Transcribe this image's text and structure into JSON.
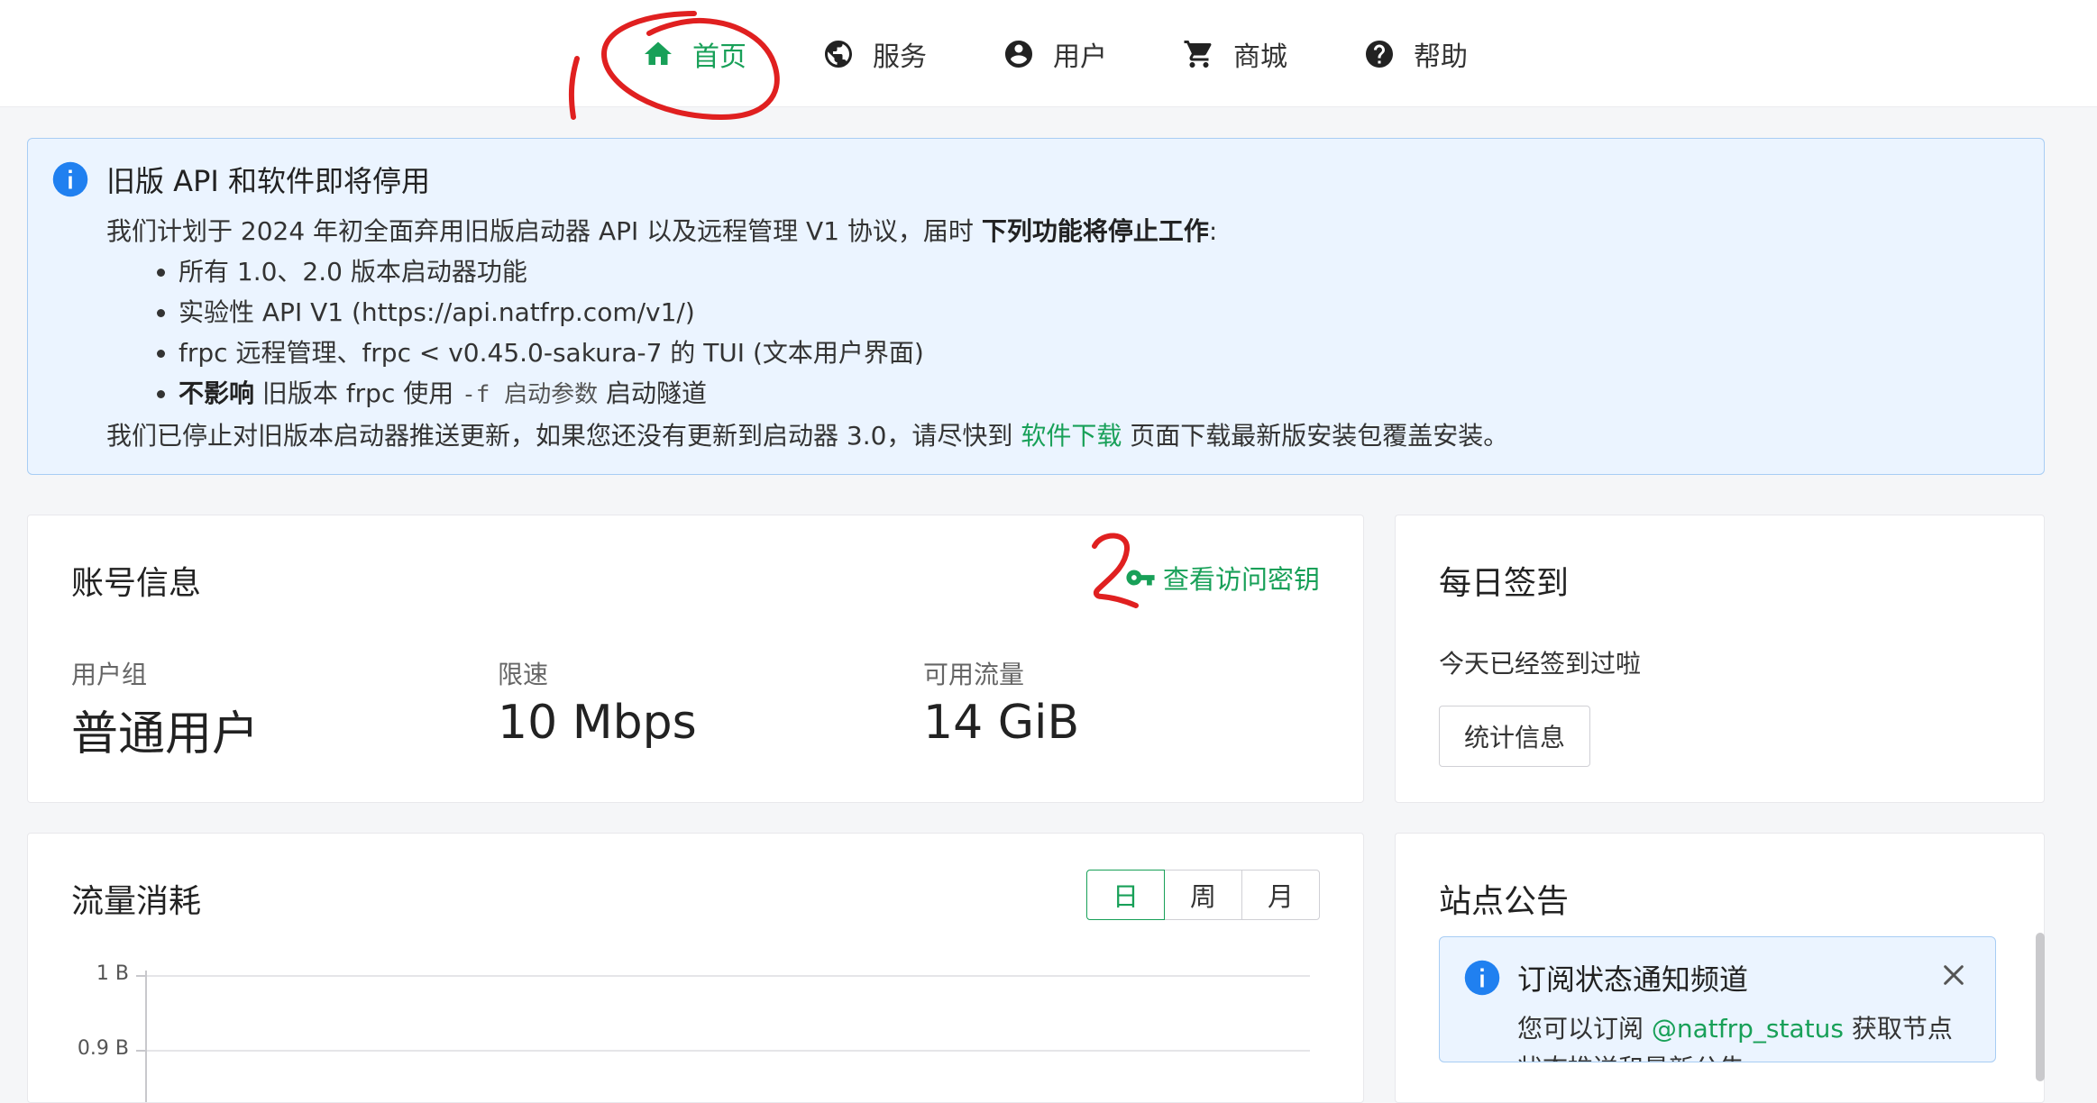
{
  "nav": {
    "items": [
      {
        "label": "首页",
        "icon": "home-icon",
        "active": true
      },
      {
        "label": "服务",
        "icon": "globe-icon"
      },
      {
        "label": "用户",
        "icon": "user-circle-icon"
      },
      {
        "label": "商城",
        "icon": "cart-icon"
      },
      {
        "label": "帮助",
        "icon": "help-icon"
      }
    ]
  },
  "annotations": {
    "mark1": "1",
    "mark2": "2",
    "color": "#e02020"
  },
  "alert": {
    "title": "旧版 API 和软件即将停用",
    "intro_prefix": "我们计划于 2024 年初全面弃用旧版启动器 API 以及远程管理 V1 协议，届时 ",
    "intro_bold": "下列功能将停止工作",
    "intro_suffix": ":",
    "bullets": [
      "所有 1.0、2.0 版本启动器功能",
      "实验性 API V1 (https://api.natfrp.com/v1/)",
      "frpc 远程管理、frpc < v0.45.0-sakura-7 的 TUI (文本用户界面)"
    ],
    "bullet4_bold": "不影响",
    "bullet4_text1": " 旧版本 frpc 使用 ",
    "bullet4_code": "-f 启动参数",
    "bullet4_text2": " 启动隧道",
    "outro_prefix": "我们已停止对旧版本启动器推送更新，如果您还没有更新到启动器 3.0，请尽快到 ",
    "outro_link": "软件下载",
    "outro_suffix": " 页面下载最新版安装包覆盖安装。"
  },
  "account": {
    "title": "账号信息",
    "key_link": "查看访问密钥",
    "stats": [
      {
        "label": "用户组",
        "value": "普通用户"
      },
      {
        "label": "限速",
        "value": "10 Mbps"
      },
      {
        "label": "可用流量",
        "value": "14 GiB"
      }
    ]
  },
  "checkin": {
    "title": "每日签到",
    "status": "今天已经签到过啦",
    "button": "统计信息"
  },
  "traffic": {
    "title": "流量消耗",
    "tabs": [
      {
        "label": "日",
        "active": true
      },
      {
        "label": "周"
      },
      {
        "label": "月"
      }
    ]
  },
  "chart_data": {
    "type": "line",
    "title": "",
    "ylabel": "",
    "y_ticks_visible": [
      "1 B",
      "0.9 B"
    ],
    "series": [],
    "grid": true
  },
  "announcements": {
    "title": "站点公告",
    "notice_title": "订阅状态通知频道",
    "notice_prefix": "您可以订阅 ",
    "notice_link": "@natfrp_status",
    "notice_suffix": " 获取节点状态推送和最新公告"
  }
}
